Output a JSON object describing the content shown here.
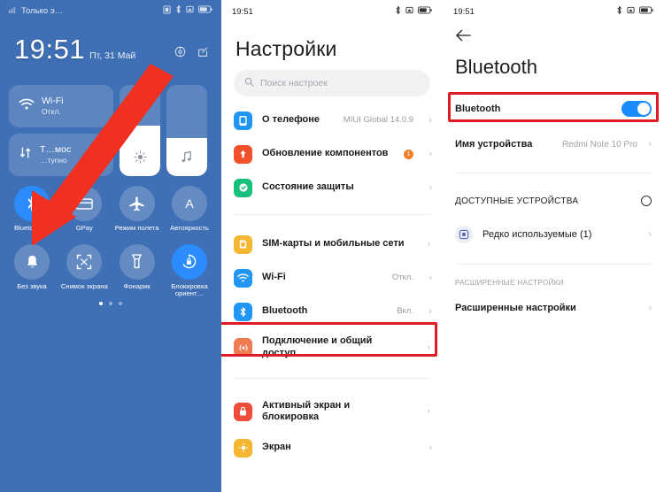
{
  "panel_quicksettings": {
    "statusbar": {
      "carrier": "Только э…",
      "signal_icon": "signal-bars-icon",
      "icons": [
        "sim-card-icon",
        "bluetooth-icon",
        "alarm-icon",
        "battery-icon"
      ]
    },
    "clock": {
      "time": "19:51",
      "date": "Пт, 31 Май"
    },
    "header_icons": [
      "settings-gear-icon",
      "edit-icon"
    ],
    "cards": [
      {
        "title": "Wi-Fi",
        "subtitle": "Откл.",
        "icon": "wifi-icon"
      },
      {
        "title": "Т…мос",
        "subtitle": "…тупно",
        "icon": "data-transfer-icon"
      }
    ],
    "sliders": [
      {
        "name": "brightness",
        "icon": "brightness-icon",
        "level": 55
      },
      {
        "name": "volume",
        "icon": "music-note-icon",
        "level": 42
      }
    ],
    "toggles": [
      {
        "label": "Bluetooth ◢",
        "icon": "bluetooth-icon",
        "state": "on"
      },
      {
        "label": "GPay",
        "icon": "credit-card-icon",
        "state": "off"
      },
      {
        "label": "Режим полета",
        "icon": "airplane-icon",
        "state": "off"
      },
      {
        "label": "Автояркость",
        "icon": "auto-brightness-icon",
        "state": "off"
      },
      {
        "label": "Без звука",
        "icon": "bell-icon",
        "state": "off"
      },
      {
        "label": "Снимок экрана",
        "icon": "screenshot-icon",
        "state": "off"
      },
      {
        "label": "Фонарик",
        "icon": "flashlight-icon",
        "state": "off"
      },
      {
        "label": "Блокировка ориент…",
        "icon": "rotation-lock-icon",
        "state": "on"
      }
    ],
    "page_dots": {
      "count": 3,
      "active": 0
    }
  },
  "panel_settings": {
    "statusbar": {
      "time": "19:51",
      "icons": [
        "bluetooth-icon",
        "alarm-icon",
        "battery-icon"
      ]
    },
    "title": "Настройки",
    "search": {
      "placeholder": "Поиск настроек",
      "icon": "search-icon"
    },
    "groups": [
      {
        "items": [
          {
            "label": "О телефоне",
            "value": "MIUI Global 14.0.9",
            "icon": "phone-info-icon",
            "color": "#2196f3",
            "badge": null
          },
          {
            "label": "Обновление компонентов",
            "value": "",
            "icon": "update-icon",
            "color": "#f0502a",
            "badge": "1"
          },
          {
            "label": "Состояние защиты",
            "value": "",
            "icon": "shield-check-icon",
            "color": "#17c07b",
            "badge": null
          }
        ]
      },
      {
        "items": [
          {
            "label": "SIM-карты и мобильные сети",
            "value": "",
            "icon": "sim-icon",
            "color": "#f5b731",
            "badge": null
          },
          {
            "label": "Wi-Fi",
            "value": "Откл.",
            "icon": "wifi-icon",
            "color": "#2196f3",
            "badge": null
          },
          {
            "label": "Bluetooth",
            "value": "Вкл.",
            "icon": "bluetooth-icon",
            "color": "#2196f3",
            "badge": null,
            "highlighted": true
          },
          {
            "label": "Подключение и общий доступ",
            "value": "",
            "icon": "connection-icon",
            "color": "#ef7b52",
            "badge": null
          }
        ]
      },
      {
        "items": [
          {
            "label": "Активный экран и блокировка",
            "value": "",
            "icon": "lock-icon",
            "color": "#ef4d3c",
            "badge": null
          },
          {
            "label": "Экран",
            "value": "",
            "icon": "display-icon",
            "color": "#f5b731",
            "badge": null
          }
        ]
      }
    ]
  },
  "panel_bluetooth": {
    "statusbar": {
      "time": "19:51",
      "icons": [
        "bluetooth-icon",
        "alarm-icon",
        "battery-icon"
      ]
    },
    "back_icon": "back-arrow-icon",
    "title": "Bluetooth",
    "toggle_row": {
      "label": "Bluetooth",
      "state": "on"
    },
    "device_name_row": {
      "label": "Имя устройства",
      "value": "Redmi Note 10 Pro"
    },
    "available_section": {
      "header": "ДОСТУПНЫЕ УСТРОЙСТВА",
      "scanning_icon": "scanning-spinner-icon"
    },
    "devices": [
      {
        "label": "Редко используемые (1)",
        "icon": "device-square-icon"
      }
    ],
    "advanced_section": {
      "header": "РАСШИРЕННЫЕ НАСТРОЙКИ",
      "item": "Расширенные настройки"
    }
  },
  "annotations": {
    "arrow_color": "#f03020",
    "highlight_color": "#e01b24"
  }
}
